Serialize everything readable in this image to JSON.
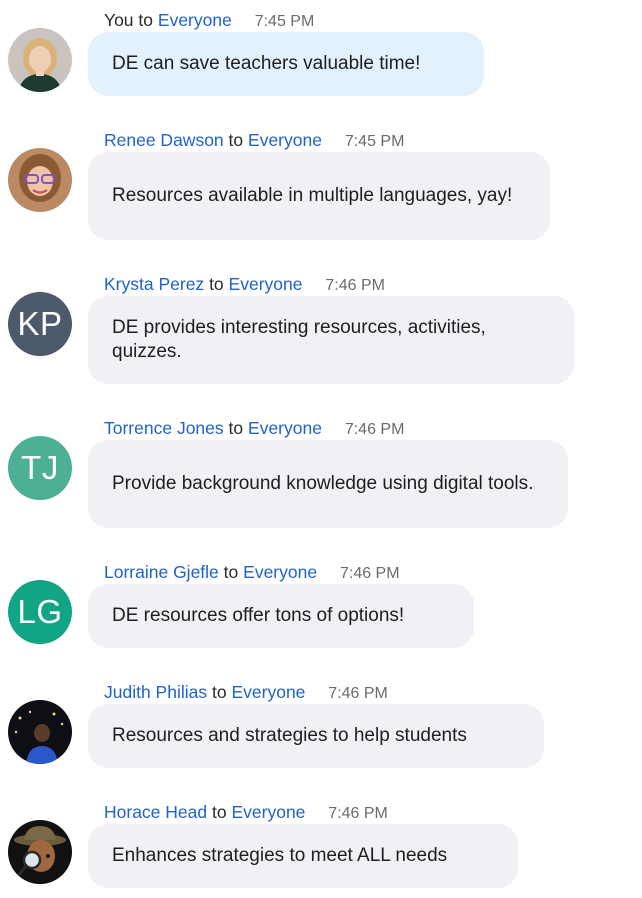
{
  "chat": {
    "messages": [
      {
        "sender": "You",
        "to": "to",
        "recipient": "Everyone",
        "time": "7:45 PM",
        "text": "DE can save teachers valuable time!",
        "avatar": "photo"
      },
      {
        "sender": "Renee Dawson",
        "to": "to",
        "recipient": "Everyone",
        "time": "7:45 PM",
        "text": "Resources available in multiple languages, yay!",
        "avatar": "photo"
      },
      {
        "sender": "Krysta Perez",
        "to": "to",
        "recipient": "Everyone",
        "time": "7:46 PM",
        "text": "DE provides interesting resources, activities, quizzes.",
        "avatar": "KP",
        "avatar_color": "#4c5a6b"
      },
      {
        "sender": "Torrence Jones",
        "to": "to",
        "recipient": "Everyone",
        "time": "7:46 PM",
        "text": "Provide background knowledge using digital tools.",
        "avatar": "TJ",
        "avatar_color": "#4daf93"
      },
      {
        "sender": "Lorraine Gjefle",
        "to": "to",
        "recipient": "Everyone",
        "time": "7:46 PM",
        "text": "DE resources offer tons of options!",
        "avatar": "LG",
        "avatar_color": "#11a585"
      },
      {
        "sender": "Judith Philias",
        "to": "to",
        "recipient": "Everyone",
        "time": "7:46 PM",
        "text": "Resources and strategies to help students",
        "avatar": "photo"
      },
      {
        "sender": "Horace Head",
        "to": "to",
        "recipient": "Everyone",
        "time": "7:46 PM",
        "text": "Enhances strategies to meet ALL needs",
        "avatar": "photo"
      }
    ]
  }
}
